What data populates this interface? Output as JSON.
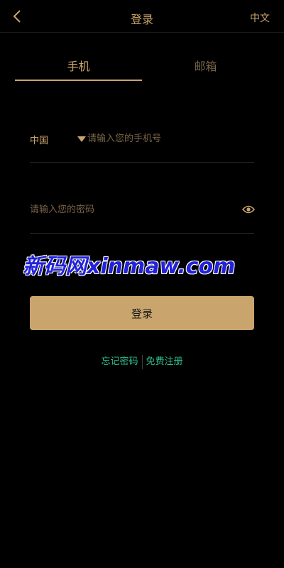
{
  "header": {
    "back_icon": "chevron-left-icon",
    "title": "登录",
    "language": "中文"
  },
  "tabs": [
    {
      "label": "手机",
      "active": true
    },
    {
      "label": "邮箱",
      "active": false
    }
  ],
  "form": {
    "country": "中国",
    "country_caret_icon": "caret-down-icon",
    "phone_placeholder": "请输入您的手机号",
    "phone_value": "",
    "password_placeholder": "请输入您的密码",
    "password_value": "",
    "eye_icon": "eye-icon"
  },
  "watermark": "新码网xinmaw.com",
  "login_button": "登录",
  "links": {
    "forgot_password": "忘记密码",
    "register": "免费注册"
  },
  "colors": {
    "background": "#000000",
    "accent": "#c9a46c",
    "link": "#2fbf8f"
  }
}
